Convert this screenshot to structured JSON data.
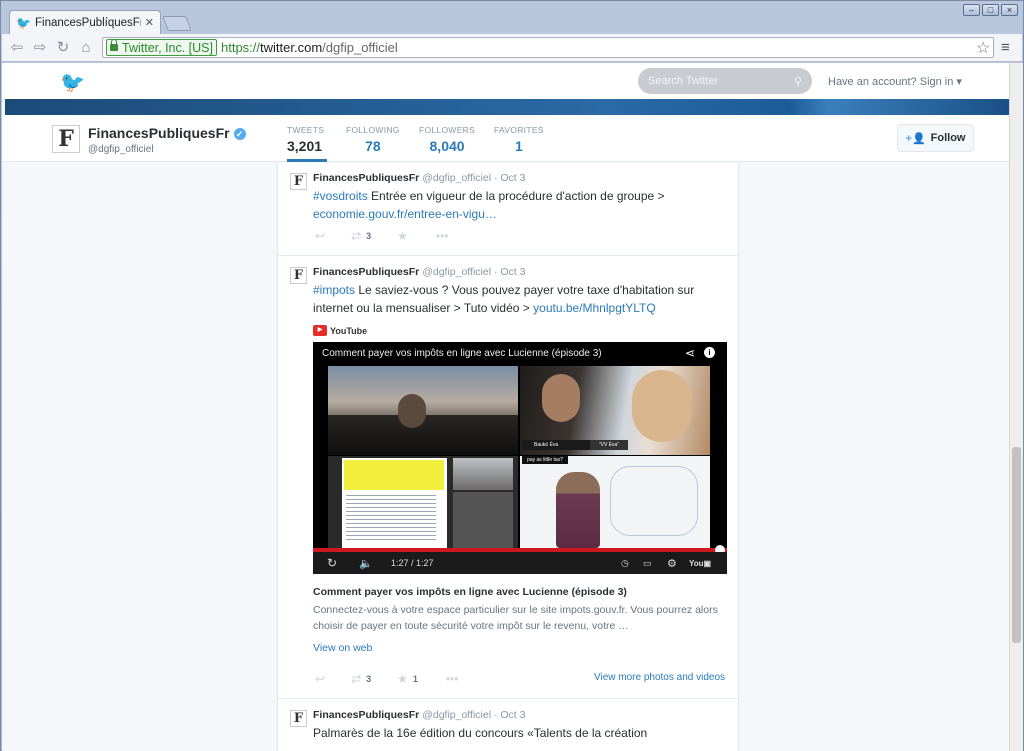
{
  "browser": {
    "tab_title": "FinancesPublíquesFr (",
    "tab_close": "✕",
    "ev_label": "Twitter, Inc. [US]",
    "url_scheme": "https://",
    "url_host": "twitter.com",
    "url_path": "/dgfip_officiel"
  },
  "twitter": {
    "search_placeholder": "Search Twitter",
    "signin": "Have an account? Sign in ▾"
  },
  "profile": {
    "name": "FinancesPubliquesFr",
    "handle": "@dgfip_officiel",
    "stats": [
      {
        "label": "TWEETS",
        "value": "3,201"
      },
      {
        "label": "FOLLOWING",
        "value": "78"
      },
      {
        "label": "FOLLOWERS",
        "value": "8,040"
      },
      {
        "label": "FAVORITES",
        "value": "1"
      }
    ],
    "follow_label": "Follow"
  },
  "tweets": [
    {
      "name": "FinancesPubliquesFr",
      "meta": "@dgfip_officiel · Oct 3",
      "hashtag": "#vosdroits",
      "text": " Entrée en vigueur de la procédure d'action de groupe > ",
      "link": "economie.gouv.fr/entree-en-vigu…",
      "retweets": "3",
      "favorites": ""
    },
    {
      "name": "FinancesPubliquesFr",
      "meta": "@dgfip_officiel · Oct 3",
      "hashtag": "#impots",
      "text": " Le saviez-vous ? Vous pouvez payer votre taxe d'habitation sur internet ou la mensualiser > Tuto vidéo > ",
      "link": "youtu.be/MhnlpgtYLTQ",
      "retweets": "3",
      "favorites": "1",
      "card": {
        "provider": "YouTube",
        "video_title": "Comment payer vos impôts en ligne avec Lucienne (épisode 3)",
        "time": "1:27 / 1:27",
        "overlay_name": "Baukó Éva",
        "overlay_tag": "\"VV Éva\"",
        "overlay_q": "pay as little tax?",
        "title": "Comment payer vos impôts en ligne avec Lucienne (épisode 3)",
        "description": "Connectez-vous à votre espace particulier sur le site impots.gouv.fr. Vous pourrez alors choisir de payer en toute sécurité votre impôt sur le revenu, votre …",
        "view_on_web": "View on web",
        "more_media": "View more photos and videos"
      }
    },
    {
      "name": "FinancesPubliquesFr",
      "meta": "@dgfip_officiel · Oct 3",
      "text": "Palmarès de la 16e édition du concours «Talents de la création"
    }
  ]
}
